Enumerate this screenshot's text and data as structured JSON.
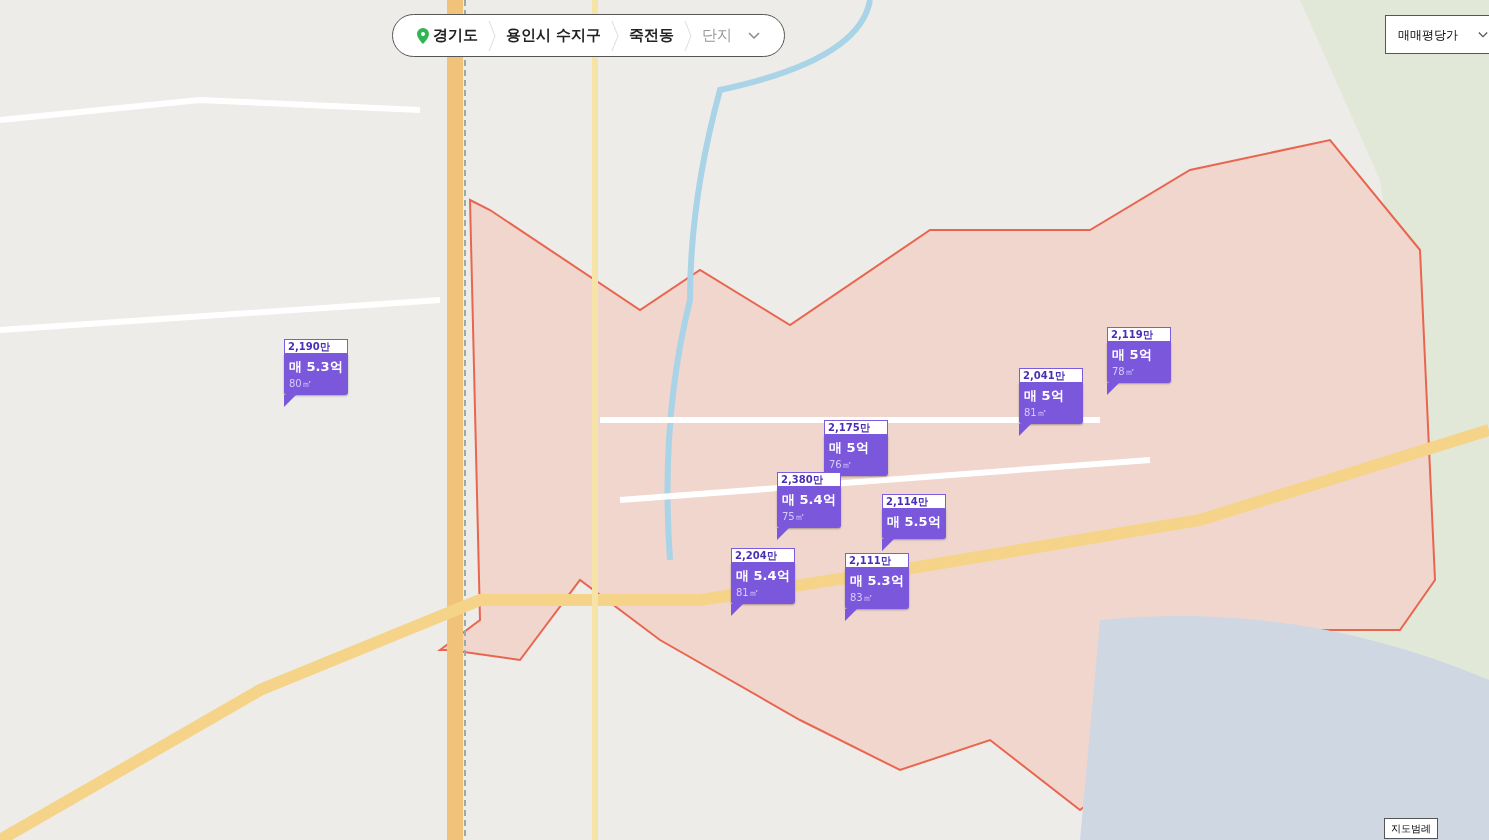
{
  "breadcrumb": [
    {
      "label": "경기도",
      "kind": "region"
    },
    {
      "label": "용인시 수지구",
      "kind": "region"
    },
    {
      "label": "죽전동",
      "kind": "region"
    },
    {
      "label": "단지",
      "kind": "dropdown"
    }
  ],
  "price_type": {
    "label": "매매평당가"
  },
  "markers": [
    {
      "per_pyeong": "2,190만",
      "price": "매 5.3억",
      "area": "80㎡"
    },
    {
      "per_pyeong": "2,119만",
      "price": "매 5억",
      "area": "78㎡"
    },
    {
      "per_pyeong": "2,041만",
      "price": "매 5억",
      "area": "81㎡"
    },
    {
      "per_pyeong": "2,175만",
      "price": "매 5억",
      "area": "76㎡"
    },
    {
      "per_pyeong": "2,380만",
      "price": "매 5.4억",
      "area": "75㎡"
    },
    {
      "per_pyeong": "2,114만",
      "price": "매 5.5억"
    },
    {
      "per_pyeong": "2,204만",
      "price": "매 5.4억",
      "area": "81㎡"
    },
    {
      "per_pyeong": "2,111만",
      "price": "매 5.3억",
      "area": "83㎡"
    }
  ],
  "legend_button": "지도범례"
}
